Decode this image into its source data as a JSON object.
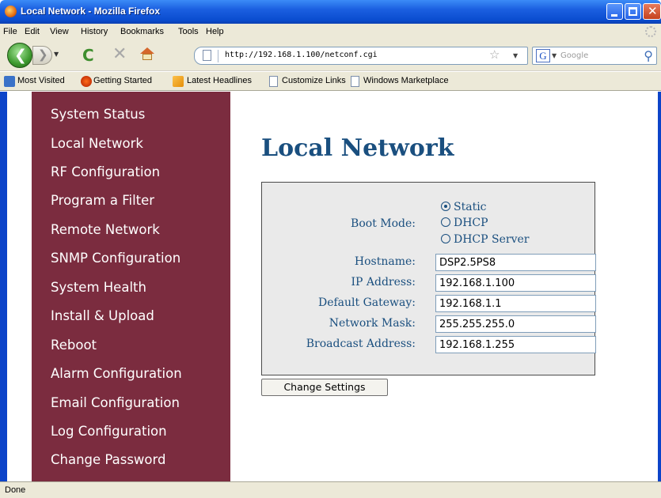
{
  "window": {
    "title": "Local Network - Mozilla Firefox"
  },
  "menu": [
    "File",
    "Edit",
    "View",
    "History",
    "Bookmarks",
    "Tools",
    "Help"
  ],
  "nav": {
    "url": "http://192.168.1.100/netconf.cgi",
    "search_placeholder": "Google",
    "search_engine": "G"
  },
  "bookmarks": [
    "Most Visited",
    "Getting Started",
    "Latest Headlines",
    "Customize Links",
    "Windows Marketplace"
  ],
  "sidebar": {
    "items": [
      "System Status",
      "Local Network",
      "RF Configuration",
      "Program a Filter",
      "Remote Network",
      "SNMP Configuration",
      "System Health",
      "Install & Upload",
      "Reboot",
      "Alarm Configuration",
      "Email Configuration",
      "Log Configuration",
      "Change Password"
    ],
    "bg_color": "#7b2c3f"
  },
  "page": {
    "title": "Local Network",
    "boot_mode_label": "Boot Mode:",
    "boot_options": [
      "Static",
      "DHCP",
      "DHCP Server"
    ],
    "boot_selected": "Static",
    "fields": [
      {
        "label": "Hostname:",
        "value": "DSP2.5PS8"
      },
      {
        "label": "IP Address:",
        "value": "192.168.1.100"
      },
      {
        "label": "Default Gateway:",
        "value": "192.168.1.1"
      },
      {
        "label": "Network Mask:",
        "value": "255.255.255.0"
      },
      {
        "label": "Broadcast Address:",
        "value": "192.168.1.255"
      }
    ],
    "submit_label": "Change Settings",
    "accent_color": "#1a4f7f"
  },
  "status": "Done"
}
